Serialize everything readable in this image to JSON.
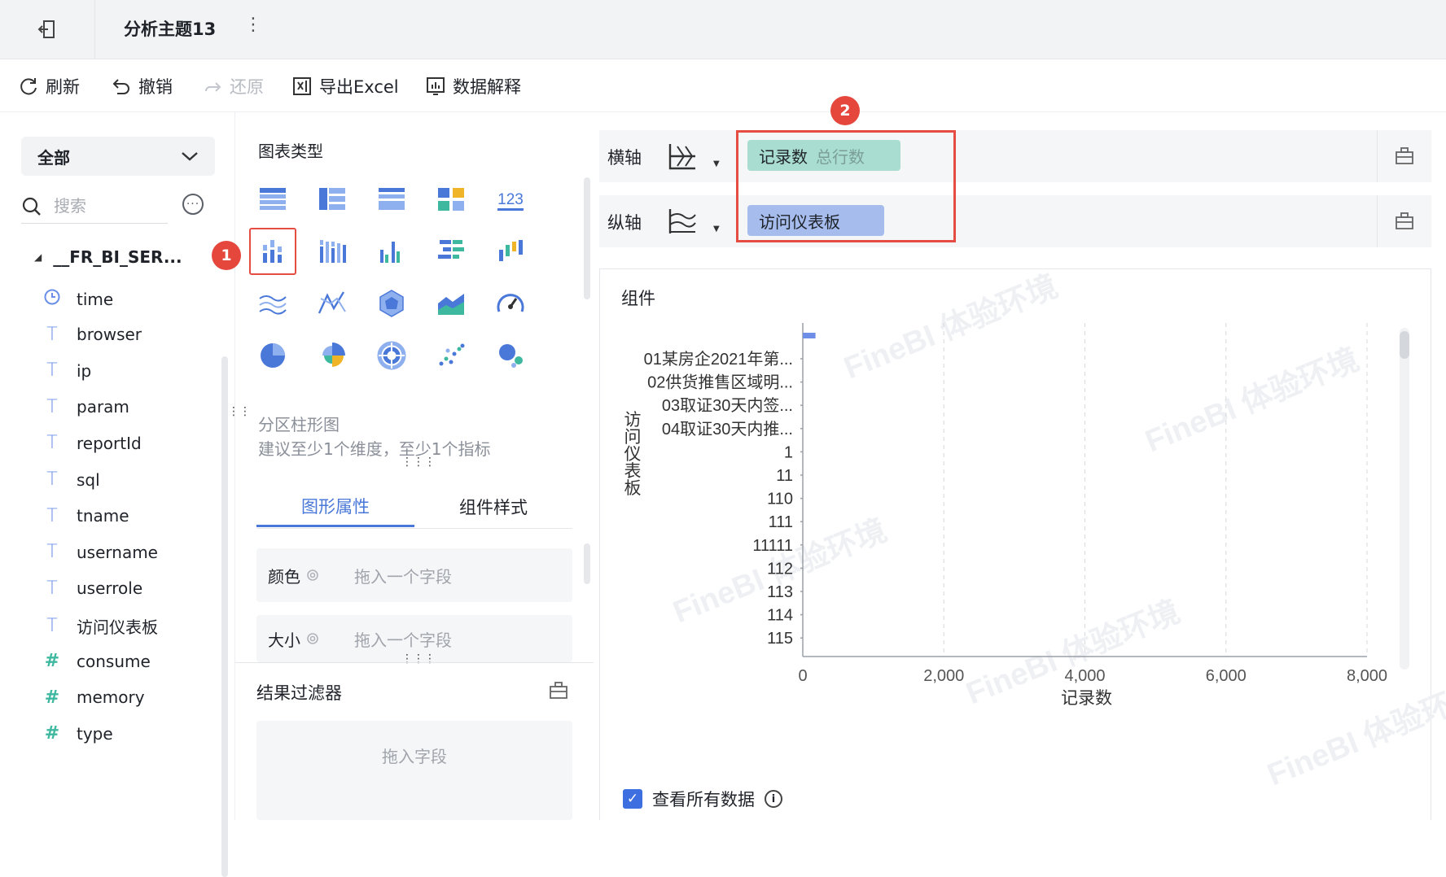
{
  "header": {
    "title": "分析主题13",
    "more_glyph": "⋮",
    "back_icon": "exit-icon"
  },
  "toolbar": [
    {
      "label": "刷新",
      "icon": "refresh-icon",
      "disabled": false
    },
    {
      "label": "撤销",
      "icon": "undo-icon",
      "disabled": false
    },
    {
      "label": "还原",
      "icon": "redo-icon",
      "disabled": true
    },
    {
      "label": "导出Excel",
      "icon": "export-excel-icon",
      "disabled": false
    },
    {
      "label": "数据解释",
      "icon": "data-explain-icon",
      "disabled": false
    }
  ],
  "field_panel": {
    "scope": "全部",
    "search_placeholder": "搜索",
    "table_name": "__FR_BI_SER...",
    "fields": [
      {
        "name": "time",
        "type": "date"
      },
      {
        "name": "browser",
        "type": "text"
      },
      {
        "name": "ip",
        "type": "text"
      },
      {
        "name": "param",
        "type": "text"
      },
      {
        "name": "reportId",
        "type": "text"
      },
      {
        "name": "sql",
        "type": "text"
      },
      {
        "name": "tname",
        "type": "text"
      },
      {
        "name": "username",
        "type": "text"
      },
      {
        "name": "userrole",
        "type": "text"
      },
      {
        "name": "访问仪表板",
        "type": "text"
      },
      {
        "name": "consume",
        "type": "number"
      },
      {
        "name": "memory",
        "type": "number"
      },
      {
        "name": "type",
        "type": "number"
      }
    ]
  },
  "chart_types": {
    "title": "图表类型",
    "selected_name": "分区柱形图",
    "selected_hint": "建议至少1个维度，至少1个指标",
    "icons": [
      "table-icon",
      "grouped-table-icon",
      "detail-table-icon",
      "kpi-card-icon",
      "number-card-icon",
      "partitioned-column-chart-icon",
      "stacked-column-chart-icon",
      "multi-series-column-chart-icon",
      "comparison-bar-chart-icon",
      "range-column-chart-icon",
      "line-chart-icon",
      "radar-line-chart-icon",
      "radar-chart-icon",
      "area-chart-icon",
      "gauge-icon",
      "pie-chart-icon",
      "rose-chart-icon",
      "multilevel-pie-icon",
      "scatter-chart-icon",
      "bubble-chart-icon"
    ],
    "selected_index": 5
  },
  "props_tabs": [
    {
      "label": "图形属性",
      "active": true
    },
    {
      "label": "组件样式",
      "active": false
    }
  ],
  "props": [
    {
      "label": "颜色",
      "placeholder": "拖入一个字段"
    },
    {
      "label": "大小",
      "placeholder": "拖入一个字段"
    }
  ],
  "filter": {
    "title": "结果过滤器",
    "placeholder": "拖入字段"
  },
  "axes": {
    "x": {
      "label": "横轴",
      "pill": "记录数",
      "pill_sub": "总行数",
      "pill_color": "#a9ddd2"
    },
    "y": {
      "label": "纵轴",
      "pill": "访问仪表板",
      "pill_color": "#a5bcec"
    }
  },
  "badges": [
    "1",
    "2"
  ],
  "component": {
    "title": "组件",
    "watermark": "FineBI 体验环境",
    "view_all_label": "查看所有数据",
    "view_all_checked": true
  },
  "chart_data": {
    "type": "bar",
    "orientation": "horizontal",
    "categories": [
      "01某房企2021年第...",
      "02供货推售区域明...",
      "03取证30天内签...",
      "04取证30天内推...",
      "1",
      "11",
      "110",
      "111",
      "11111",
      "112",
      "113",
      "114",
      "115"
    ],
    "top_bar_value": 180,
    "xlabel": "记录数",
    "ylabel": "访问仪表板",
    "xlim": [
      0,
      8000
    ],
    "xticks": [
      "0",
      "2,000",
      "4,000",
      "6,000",
      "8,000"
    ],
    "bar_color": "#6f8ee8",
    "grid": "vertical dashed"
  }
}
